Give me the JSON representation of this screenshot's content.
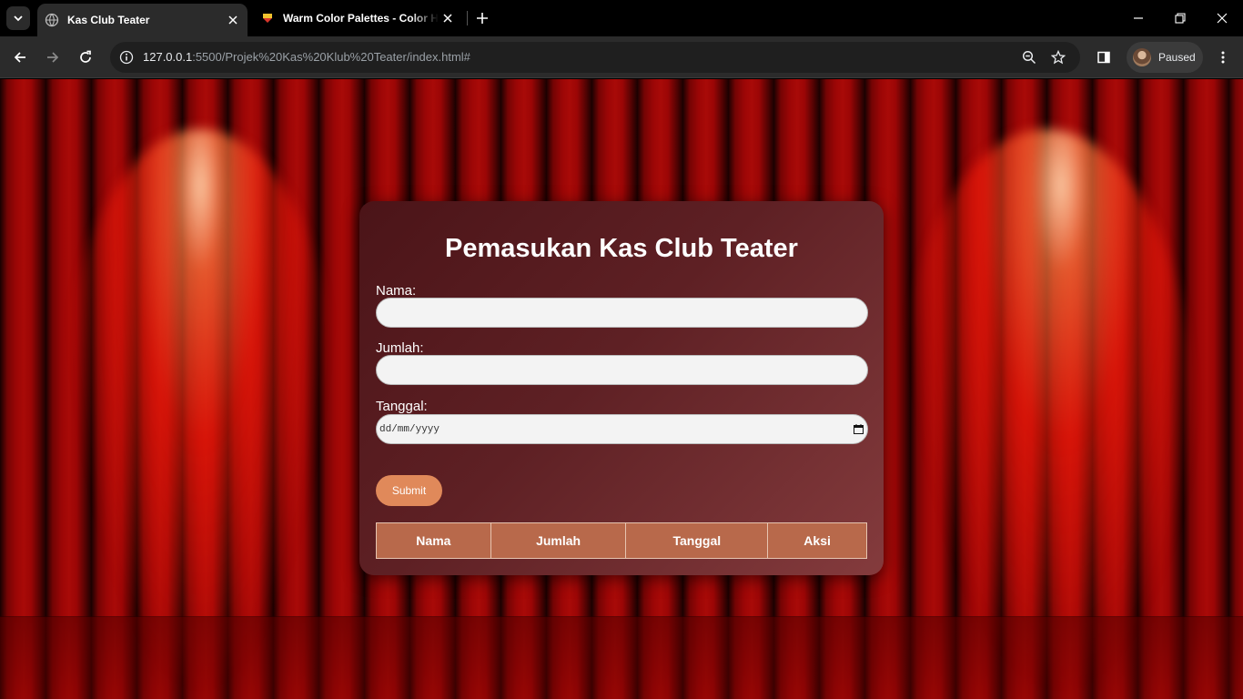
{
  "browser": {
    "tabs": [
      {
        "title": "Kas Club Teater",
        "favicon": "globe-icon",
        "active": true
      },
      {
        "title": "Warm Color Palettes - Color Hunt",
        "favicon": "color-hunt-icon",
        "active": false
      }
    ],
    "url_host": "127.0.0.1",
    "url_rest": ":5500/Projek%20Kas%20Klub%20Teater/index.html#",
    "profile_label": "Paused"
  },
  "page": {
    "title": "Pemasukan Kas Club Teater",
    "form": {
      "nama_label": "Nama:",
      "nama_value": "",
      "jumlah_label": "Jumlah:",
      "jumlah_value": "",
      "tanggal_label": "Tanggal:",
      "tanggal_placeholder": "dd/mm/yyyy",
      "submit_label": "Submit"
    },
    "table_headers": [
      "Nama",
      "Jumlah",
      "Tanggal",
      "Aksi"
    ]
  },
  "colors": {
    "card_gradient_start": "#4b1418",
    "card_gradient_end": "#843b3d",
    "submit_button": "#e0895a",
    "table_header": "#b8694b"
  }
}
